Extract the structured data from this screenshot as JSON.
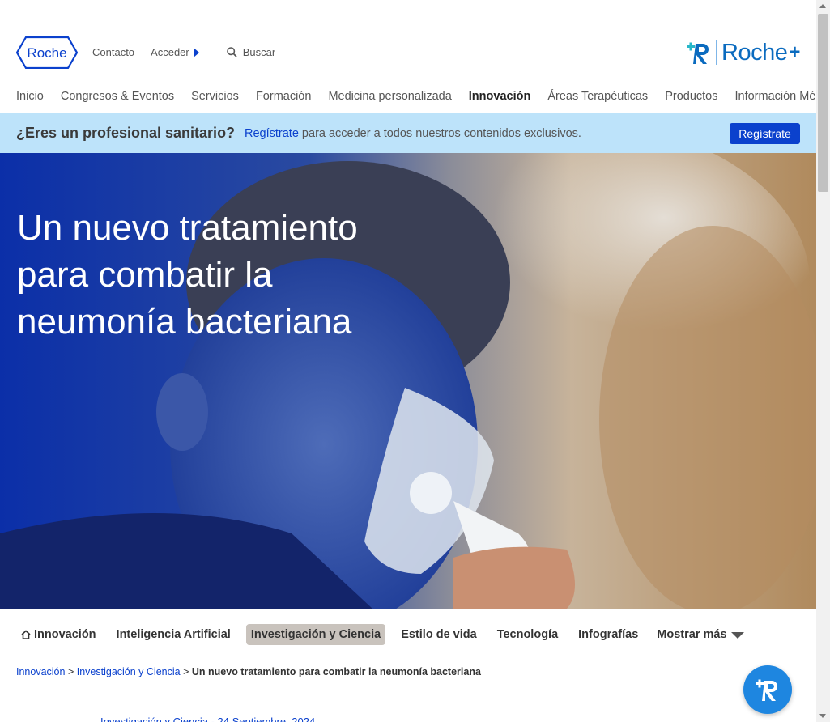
{
  "header": {
    "logo_text": "Roche",
    "top_links": {
      "contact": "Contacto",
      "login": "Acceder",
      "search": "Buscar"
    },
    "brand_plus": {
      "word": "Roche",
      "plus": "+"
    },
    "nav": [
      {
        "label": "Inicio",
        "active": false
      },
      {
        "label": "Congresos & Eventos",
        "active": false
      },
      {
        "label": "Servicios",
        "active": false
      },
      {
        "label": "Formación",
        "active": false
      },
      {
        "label": "Medicina personalizada",
        "active": false
      },
      {
        "label": "Innovación",
        "active": true
      },
      {
        "label": "Áreas Terapéuticas",
        "active": false
      },
      {
        "label": "Productos",
        "active": false
      },
      {
        "label": "Información Médica",
        "active": false
      }
    ]
  },
  "banner": {
    "question": "¿Eres un profesional sanitario?",
    "link": "Regístrate",
    "text": " para acceder a todos nuestros contenidos exclusivos.",
    "button": "Regístrate"
  },
  "hero": {
    "title": "Un nuevo tratamiento para combatir la neumonía bacteriana"
  },
  "categories": [
    {
      "label": "Innovación",
      "selected": false,
      "icon": "home-icon"
    },
    {
      "label": "Inteligencia Artificial",
      "selected": false
    },
    {
      "label": "Investigación y Ciencia",
      "selected": true
    },
    {
      "label": "Estilo de vida",
      "selected": false
    },
    {
      "label": "Tecnología",
      "selected": false
    },
    {
      "label": "Infografías",
      "selected": false
    }
  ],
  "more": "Mostrar más",
  "breadcrumb": {
    "items": [
      "Innovación",
      "Investigación y Ciencia"
    ],
    "separator": ">",
    "current": "Un nuevo tratamiento para combatir la neumonía bacteriana"
  },
  "meta": "Investigación y Ciencia - 24 Septiembre, 2024",
  "colors": {
    "brand_blue": "#0b41cd",
    "banner_bg": "#bde3fa",
    "fab_blue": "#1e86e0",
    "selected_tab": "#c9c3bd"
  }
}
